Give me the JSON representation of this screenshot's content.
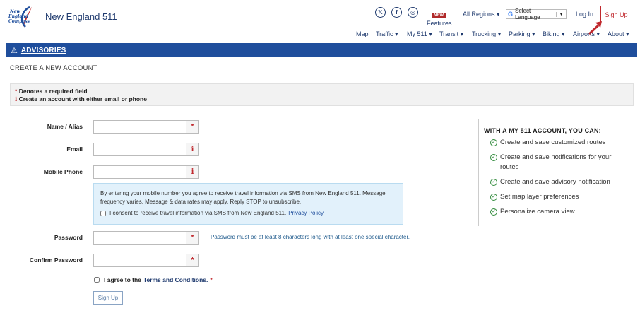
{
  "header": {
    "brand": "New England 511",
    "social": [
      {
        "icon": "x-twitter-icon",
        "glyph": "𝕏"
      },
      {
        "icon": "facebook-icon",
        "glyph": "f"
      },
      {
        "icon": "instagram-icon",
        "glyph": "◎"
      }
    ],
    "features_badge": "NEW",
    "features_label": "Features",
    "regions_label": "All Regions",
    "language_label": "Select Language",
    "login_label": "Log In",
    "signup_label": "Sign Up",
    "accent_color": "#1f4e9c",
    "highlight_color": "#c0282d"
  },
  "nav": {
    "map": "Map",
    "traffic": "Traffic",
    "my511": "My 511",
    "transit": "Transit",
    "trucking": "Trucking",
    "parking": "Parking",
    "biking": "Biking",
    "airports": "Airports",
    "about": "About"
  },
  "advisories": {
    "label": "ADVISORIES"
  },
  "page": {
    "title": "CREATE A NEW ACCOUNT"
  },
  "notice": {
    "required": "Denotes a required field",
    "either": "Create an account with either email or phone"
  },
  "form": {
    "name_label": "Name / Alias",
    "email_label": "Email",
    "phone_label": "Mobile Phone",
    "sms_text": "By entering your mobile number you agree to receive travel information via SMS from New England 511. Message frequency varies. Message & data rates may apply. Reply STOP to unsubscribe.",
    "sms_consent": "I consent to receive travel information via SMS from New England 511.",
    "privacy_link": "Privacy Policy",
    "password_label": "Password",
    "password_hint": "Password must be at least 8 characters long with at least one special character.",
    "confirm_label": "Confirm Password",
    "agree_text": "I agree to the",
    "terms_link": "Terms and Conditions.",
    "submit_label": "Sign Up"
  },
  "benefits": {
    "title": "WITH A MY 511 ACCOUNT, YOU CAN:",
    "items": [
      "Create and save customized routes",
      "Create and save notifications for your routes",
      "Create and save advisory notification",
      "Set map layer preferences",
      "Personalize camera view"
    ]
  }
}
